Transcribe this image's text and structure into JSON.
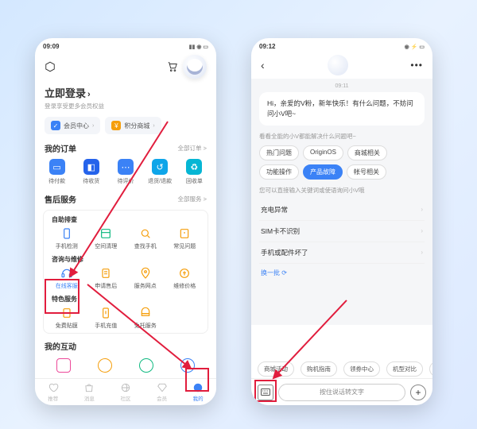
{
  "left": {
    "status_time": "09:09",
    "login_title": "立即登录",
    "login_sub": "登录享受更多会员权益",
    "pills": {
      "member": "会员中心",
      "points": "积分商城"
    },
    "orders": {
      "title": "我的订单",
      "more": "全部订单 >",
      "items": [
        "待付款",
        "待收货",
        "待评价",
        "退货/退款",
        "回收单"
      ]
    },
    "aftersale": {
      "title": "售后服务",
      "more": "全部服务 >",
      "self_title": "自助排查",
      "self_items": [
        "手机检测",
        "空间清理",
        "查找手机",
        "常见问题"
      ],
      "consult_title": "咨询与维修",
      "consult_items": [
        "在线客服",
        "申请售后",
        "服务网点",
        "维修价格"
      ],
      "special_title": "特色服务",
      "special_items": [
        "免费贴膜",
        "手机充值",
        "免托服务"
      ]
    },
    "interact_title": "我的互动",
    "tabs": [
      "推荐",
      "消息",
      "社区",
      "会员",
      "我的"
    ]
  },
  "right": {
    "status_time": "09:12",
    "chat_time": "09:11",
    "greeting": "Hi，亲爱的V粉，新年快乐！有什么问题，不妨问问小V吧~",
    "hint1": "看看全能的小V都能解决什么问题吧~",
    "chips": [
      "热门问题",
      "OriginOS",
      "商城相关",
      "功能操作",
      "产品故障",
      "帐号相关"
    ],
    "active_chip_index": 4,
    "hint2": "您可以直接输入关键词或使语询问小V哦",
    "qa": [
      "充电异常",
      "SIM卡不识别",
      "手机或配件坏了"
    ],
    "refresh": "换一批",
    "quick": [
      "商城活动",
      "购机指南",
      "领券中心",
      "机型对比",
      "以"
    ],
    "voice_placeholder": "按住说话转文字"
  }
}
